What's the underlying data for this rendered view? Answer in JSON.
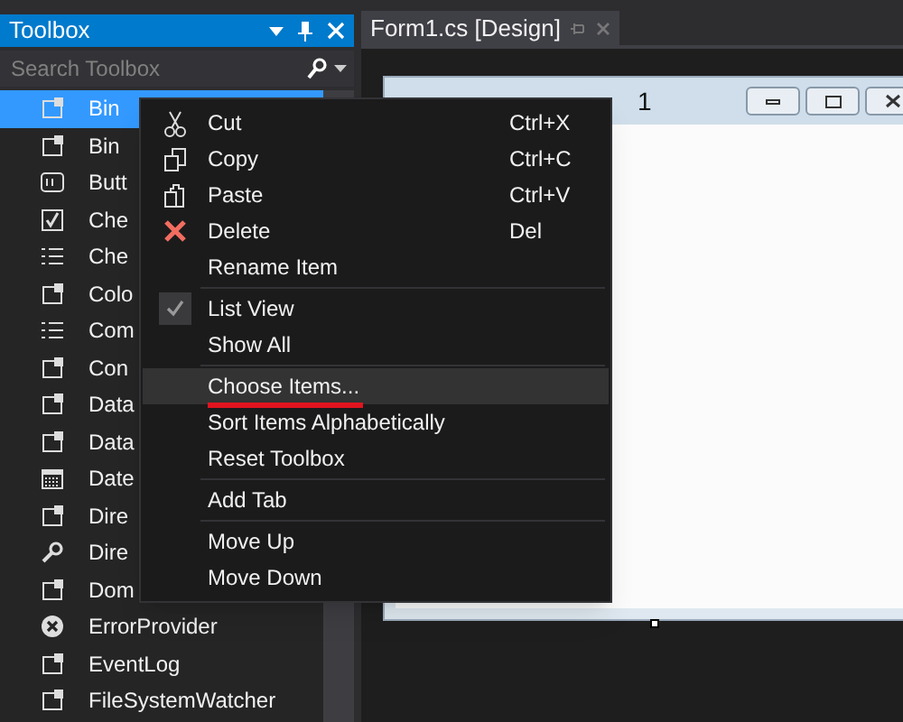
{
  "toolbox": {
    "title": "Toolbox",
    "search": {
      "placeholder": "Search Toolbox"
    },
    "items": [
      {
        "label": "Bin",
        "selected": true
      },
      {
        "label": "Bin",
        "selected": false
      },
      {
        "label": "Butt",
        "selected": false
      },
      {
        "label": "Che",
        "selected": false
      },
      {
        "label": "Che",
        "selected": false
      },
      {
        "label": "Colo",
        "selected": false
      },
      {
        "label": "Com",
        "selected": false
      },
      {
        "label": "Con",
        "selected": false
      },
      {
        "label": "Data",
        "selected": false
      },
      {
        "label": "Data",
        "selected": false
      },
      {
        "label": "Date",
        "selected": false
      },
      {
        "label": "Dire",
        "selected": false
      },
      {
        "label": "Dire",
        "selected": false
      },
      {
        "label": "Dom",
        "selected": false
      },
      {
        "label": "ErrorProvider",
        "selected": false
      },
      {
        "label": "EventLog",
        "selected": false
      },
      {
        "label": "FileSystemWatcher",
        "selected": false
      }
    ]
  },
  "document_tab": {
    "title": "Form1.cs [Design]",
    "selected": true
  },
  "form": {
    "title": "1"
  },
  "context_menu": {
    "groups": [
      [
        {
          "label": "Cut",
          "shortcut": "Ctrl+X",
          "checked": false,
          "selected": false,
          "underlined": false
        },
        {
          "label": "Copy",
          "shortcut": "Ctrl+C",
          "checked": false,
          "selected": false,
          "underlined": false
        },
        {
          "label": "Paste",
          "shortcut": "Ctrl+V",
          "checked": false,
          "selected": false,
          "underlined": false
        },
        {
          "label": "Delete",
          "shortcut": "Del",
          "checked": false,
          "selected": false,
          "underlined": false
        },
        {
          "label": "Rename Item",
          "checked": false,
          "selected": false,
          "underlined": false
        }
      ],
      [
        {
          "label": "List View",
          "checked": true,
          "selected": false,
          "underlined": false
        },
        {
          "label": "Show All",
          "checked": false,
          "selected": false,
          "underlined": false
        }
      ],
      [
        {
          "label": "Choose Items...",
          "checked": false,
          "selected": true,
          "underlined": true
        },
        {
          "label": "Sort Items Alphabetically",
          "checked": false,
          "selected": false,
          "underlined": false
        },
        {
          "label": "Reset Toolbox",
          "checked": false,
          "selected": false,
          "underlined": false
        }
      ],
      [
        {
          "label": "Add Tab",
          "checked": false,
          "selected": false,
          "underlined": false
        }
      ],
      [
        {
          "label": "Move Up",
          "checked": false,
          "selected": false,
          "underlined": false
        },
        {
          "label": "Move Down",
          "checked": false,
          "selected": false,
          "underlined": false
        }
      ]
    ]
  }
}
